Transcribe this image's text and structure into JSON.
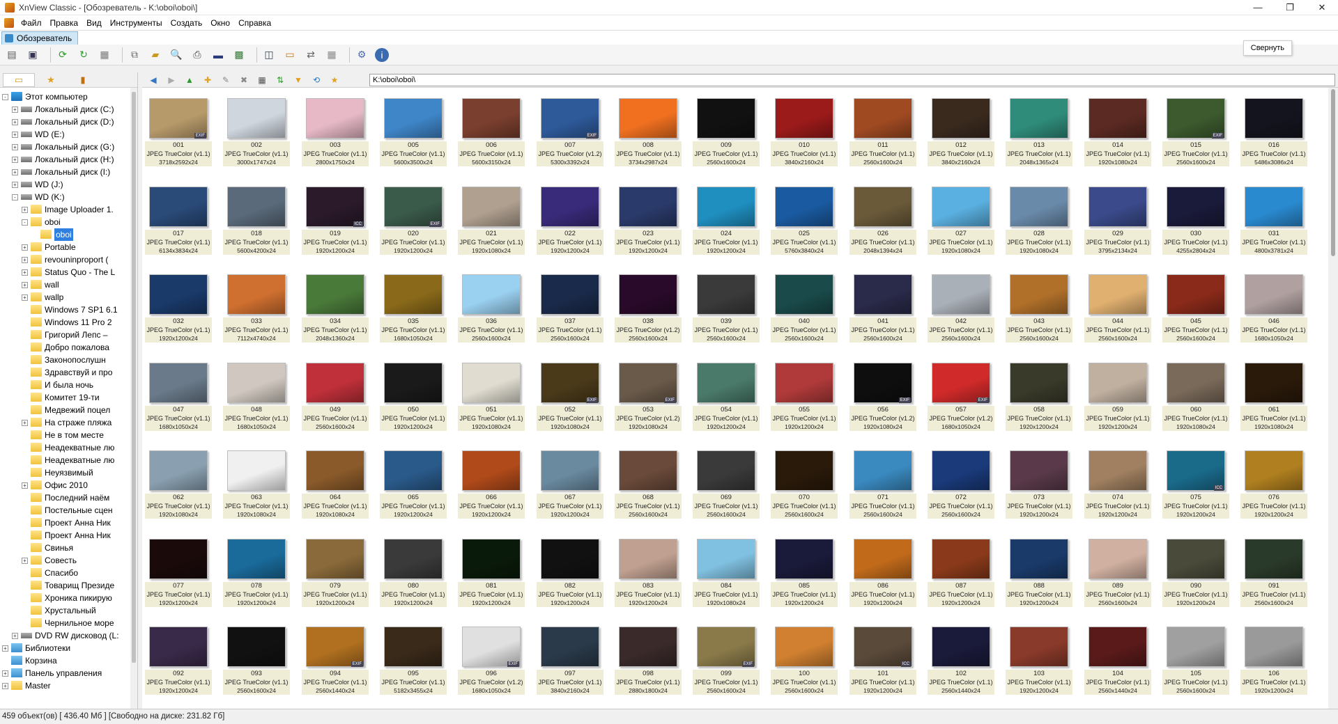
{
  "window": {
    "title": "XnView Classic - [Обозреватель - K:\\oboi\\oboi\\]",
    "tooltip": "Свернуть"
  },
  "menu": [
    "Файл",
    "Правка",
    "Вид",
    "Инструменты",
    "Создать",
    "Окно",
    "Справка"
  ],
  "tab": {
    "label": "Обозреватель"
  },
  "address": "K:\\oboi\\oboi\\",
  "tree": [
    {
      "label": "Этот компьютер",
      "level": 0,
      "icon": "pc",
      "exp": "-"
    },
    {
      "label": "Локальный диск (C:)",
      "level": 1,
      "icon": "disk",
      "exp": "+"
    },
    {
      "label": "Локальный диск (D:)",
      "level": 1,
      "icon": "disk",
      "exp": "+"
    },
    {
      "label": "WD (E:)",
      "level": 1,
      "icon": "disk",
      "exp": "+"
    },
    {
      "label": "Локальный диск (G:)",
      "level": 1,
      "icon": "disk",
      "exp": "+"
    },
    {
      "label": "Локальный диск (H:)",
      "level": 1,
      "icon": "disk",
      "exp": "+"
    },
    {
      "label": "Локальный диск (I:)",
      "level": 1,
      "icon": "disk",
      "exp": "+"
    },
    {
      "label": "WD (J:)",
      "level": 1,
      "icon": "disk",
      "exp": "+"
    },
    {
      "label": "WD (K:)",
      "level": 1,
      "icon": "disk",
      "exp": "-"
    },
    {
      "label": "Image Uploader 1.",
      "level": 2,
      "icon": "folder",
      "exp": "+"
    },
    {
      "label": "oboi",
      "level": 2,
      "icon": "folder",
      "exp": "-"
    },
    {
      "label": "oboi",
      "level": 3,
      "icon": "folder",
      "exp": "",
      "selected": true
    },
    {
      "label": "Portable",
      "level": 2,
      "icon": "folder",
      "exp": "+"
    },
    {
      "label": "revouninproport (",
      "level": 2,
      "icon": "folder",
      "exp": "+"
    },
    {
      "label": "Status Quo - The L",
      "level": 2,
      "icon": "folder",
      "exp": "+"
    },
    {
      "label": "wall",
      "level": 2,
      "icon": "folder",
      "exp": "+"
    },
    {
      "label": "wallp",
      "level": 2,
      "icon": "folder",
      "exp": "+"
    },
    {
      "label": "Windows 7 SP1 6.1",
      "level": 2,
      "icon": "folder",
      "exp": ""
    },
    {
      "label": "Windows 11 Pro 2",
      "level": 2,
      "icon": "folder",
      "exp": ""
    },
    {
      "label": "Григорий Лепс –",
      "level": 2,
      "icon": "folder",
      "exp": ""
    },
    {
      "label": "Добро пожалова",
      "level": 2,
      "icon": "folder",
      "exp": ""
    },
    {
      "label": "Законопослушн",
      "level": 2,
      "icon": "folder",
      "exp": ""
    },
    {
      "label": "Здравствуй и про",
      "level": 2,
      "icon": "folder",
      "exp": ""
    },
    {
      "label": "И была ночь",
      "level": 2,
      "icon": "folder",
      "exp": ""
    },
    {
      "label": "Комитет 19-ти",
      "level": 2,
      "icon": "folder",
      "exp": ""
    },
    {
      "label": "Медвежий поцел",
      "level": 2,
      "icon": "folder",
      "exp": ""
    },
    {
      "label": "На страже пляжа",
      "level": 2,
      "icon": "folder",
      "exp": "+"
    },
    {
      "label": "Не в том месте",
      "level": 2,
      "icon": "folder",
      "exp": ""
    },
    {
      "label": "Неадекватные лю",
      "level": 2,
      "icon": "folder",
      "exp": ""
    },
    {
      "label": "Неадекватные лю",
      "level": 2,
      "icon": "folder",
      "exp": ""
    },
    {
      "label": "Неуязвимый",
      "level": 2,
      "icon": "folder",
      "exp": ""
    },
    {
      "label": "Офис 2010",
      "level": 2,
      "icon": "folder",
      "exp": "+"
    },
    {
      "label": "Последний наём",
      "level": 2,
      "icon": "folder",
      "exp": ""
    },
    {
      "label": "Постельные сцен",
      "level": 2,
      "icon": "folder",
      "exp": ""
    },
    {
      "label": "Проект Анна Ник",
      "level": 2,
      "icon": "folder",
      "exp": ""
    },
    {
      "label": "Проект Анна Ник",
      "level": 2,
      "icon": "folder",
      "exp": ""
    },
    {
      "label": "Свинья",
      "level": 2,
      "icon": "folder",
      "exp": ""
    },
    {
      "label": "Совесть",
      "level": 2,
      "icon": "folder",
      "exp": "+"
    },
    {
      "label": "Спасибо",
      "level": 2,
      "icon": "folder",
      "exp": ""
    },
    {
      "label": "Товарищ Президе",
      "level": 2,
      "icon": "folder",
      "exp": ""
    },
    {
      "label": "Хроника пикирую",
      "level": 2,
      "icon": "folder",
      "exp": ""
    },
    {
      "label": "Хрустальный",
      "level": 2,
      "icon": "folder",
      "exp": ""
    },
    {
      "label": "Чернильное море",
      "level": 2,
      "icon": "folder",
      "exp": ""
    },
    {
      "label": "DVD RW дисковод (L:",
      "level": 1,
      "icon": "disk",
      "exp": "+"
    },
    {
      "label": "Библиотеки",
      "level": 0,
      "icon": "lib",
      "exp": "+"
    },
    {
      "label": "Корзина",
      "level": 0,
      "icon": "lib",
      "exp": ""
    },
    {
      "label": "Панель управления",
      "level": 0,
      "icon": "lib",
      "exp": "+"
    },
    {
      "label": "Master",
      "level": 0,
      "icon": "folder",
      "exp": "+"
    }
  ],
  "thumbs": [
    {
      "n": "001",
      "f": "JPEG TrueColor (v1.1)",
      "d": "3718x2592x24",
      "c": "#b79a6a",
      "b": "EXIF"
    },
    {
      "n": "002",
      "f": "JPEG TrueColor (v1.1)",
      "d": "3000x1747x24",
      "c": "#cfd6de"
    },
    {
      "n": "003",
      "f": "JPEG TrueColor (v1.1)",
      "d": "2800x1750x24",
      "c": "#e7b9c6"
    },
    {
      "n": "005",
      "f": "JPEG TrueColor (v1.1)",
      "d": "5600x3500x24",
      "c": "#3f86c9"
    },
    {
      "n": "006",
      "f": "JPEG TrueColor (v1.1)",
      "d": "5600x3150x24",
      "c": "#7a3f2e"
    },
    {
      "n": "007",
      "f": "JPEG TrueColor (v1.2)",
      "d": "5300x3392x24",
      "c": "#2e5a9a",
      "b": "EXIF"
    },
    {
      "n": "008",
      "f": "JPEG TrueColor (v1.1)",
      "d": "3734x2987x24",
      "c": "#f07020"
    },
    {
      "n": "009",
      "f": "JPEG TrueColor (v1.1)",
      "d": "2560x1600x24",
      "c": "#111111"
    },
    {
      "n": "010",
      "f": "JPEG TrueColor (v1.1)",
      "d": "3840x2160x24",
      "c": "#9b1a1a"
    },
    {
      "n": "011",
      "f": "JPEG TrueColor (v1.1)",
      "d": "2560x1600x24",
      "c": "#a04a22"
    },
    {
      "n": "012",
      "f": "JPEG TrueColor (v1.1)",
      "d": "3840x2160x24",
      "c": "#3a2a1e"
    },
    {
      "n": "013",
      "f": "JPEG TrueColor (v1.1)",
      "d": "2048x1365x24",
      "c": "#2f8c7a"
    },
    {
      "n": "014",
      "f": "JPEG TrueColor (v1.1)",
      "d": "1920x1080x24",
      "c": "#5b2a22"
    },
    {
      "n": "015",
      "f": "JPEG TrueColor (v1.1)",
      "d": "2560x1600x24",
      "c": "#3c5a2e",
      "b": "EXIF"
    },
    {
      "n": "016",
      "f": "JPEG TrueColor (v1.1)",
      "d": "5486x3086x24",
      "c": "#14141e"
    },
    {
      "n": "017",
      "f": "JPEG TrueColor (v1.1)",
      "d": "6134x3834x24",
      "c": "#2a4a78"
    },
    {
      "n": "018",
      "f": "JPEG TrueColor (v1.1)",
      "d": "5600x4200x24",
      "c": "#5a6a7a"
    },
    {
      "n": "019",
      "f": "JPEG TrueColor (v1.1)",
      "d": "1920x1200x24",
      "c": "#2a1a2a",
      "b": "ICC"
    },
    {
      "n": "020",
      "f": "JPEG TrueColor (v1.1)",
      "d": "1920x1200x24",
      "c": "#3a5a4a",
      "b": "EXIF"
    },
    {
      "n": "021",
      "f": "JPEG TrueColor (v1.1)",
      "d": "1920x1080x24",
      "c": "#b0a090"
    },
    {
      "n": "022",
      "f": "JPEG TrueColor (v1.1)",
      "d": "1920x1200x24",
      "c": "#3a2a7a"
    },
    {
      "n": "023",
      "f": "JPEG TrueColor (v1.1)",
      "d": "1920x1200x24",
      "c": "#2a3a6a"
    },
    {
      "n": "024",
      "f": "JPEG TrueColor (v1.1)",
      "d": "1920x1200x24",
      "c": "#1f8fc0"
    },
    {
      "n": "025",
      "f": "JPEG TrueColor (v1.1)",
      "d": "5760x3840x24",
      "c": "#1a5aa0"
    },
    {
      "n": "026",
      "f": "JPEG TrueColor (v1.1)",
      "d": "2048x1394x24",
      "c": "#6a5a3a"
    },
    {
      "n": "027",
      "f": "JPEG TrueColor (v1.1)",
      "d": "1920x1080x24",
      "c": "#5ab0e0"
    },
    {
      "n": "028",
      "f": "JPEG TrueColor (v1.1)",
      "d": "1920x1080x24",
      "c": "#6a8aaa"
    },
    {
      "n": "029",
      "f": "JPEG TrueColor (v1.1)",
      "d": "3795x2134x24",
      "c": "#3a4a8a"
    },
    {
      "n": "030",
      "f": "JPEG TrueColor (v1.1)",
      "d": "4255x2804x24",
      "c": "#1a1a3a"
    },
    {
      "n": "031",
      "f": "JPEG TrueColor (v1.1)",
      "d": "4800x3781x24",
      "c": "#2a8ad0"
    },
    {
      "n": "032",
      "f": "JPEG TrueColor (v1.1)",
      "d": "1920x1200x24",
      "c": "#1a3a6a"
    },
    {
      "n": "033",
      "f": "JPEG TrueColor (v1.1)",
      "d": "7112x4740x24",
      "c": "#d07030"
    },
    {
      "n": "034",
      "f": "JPEG TrueColor (v1.1)",
      "d": "2048x1360x24",
      "c": "#4a7a3a"
    },
    {
      "n": "035",
      "f": "JPEG TrueColor (v1.1)",
      "d": "1680x1050x24",
      "c": "#8a6a1a"
    },
    {
      "n": "036",
      "f": "JPEG TrueColor (v1.1)",
      "d": "2560x1600x24",
      "c": "#9ad0f0"
    },
    {
      "n": "037",
      "f": "JPEG TrueColor (v1.1)",
      "d": "2560x1600x24",
      "c": "#1a2a4a"
    },
    {
      "n": "038",
      "f": "JPEG TrueColor (v1.2)",
      "d": "2560x1600x24",
      "c": "#2a0a2a"
    },
    {
      "n": "039",
      "f": "JPEG TrueColor (v1.1)",
      "d": "2560x1600x24",
      "c": "#3a3a3a"
    },
    {
      "n": "040",
      "f": "JPEG TrueColor (v1.1)",
      "d": "2560x1600x24",
      "c": "#1a4a4a"
    },
    {
      "n": "041",
      "f": "JPEG TrueColor (v1.1)",
      "d": "2560x1600x24",
      "c": "#2a2a4a"
    },
    {
      "n": "042",
      "f": "JPEG TrueColor (v1.1)",
      "d": "2560x1600x24",
      "c": "#aab0b8"
    },
    {
      "n": "043",
      "f": "JPEG TrueColor (v1.1)",
      "d": "2560x1600x24",
      "c": "#b0702a"
    },
    {
      "n": "044",
      "f": "JPEG TrueColor (v1.1)",
      "d": "2560x1600x24",
      "c": "#e0b070"
    },
    {
      "n": "045",
      "f": "JPEG TrueColor (v1.1)",
      "d": "2560x1600x24",
      "c": "#8a2a1a"
    },
    {
      "n": "046",
      "f": "JPEG TrueColor (v1.1)",
      "d": "1680x1050x24",
      "c": "#b0a0a0"
    },
    {
      "n": "047",
      "f": "JPEG TrueColor (v1.1)",
      "d": "1680x1050x24",
      "c": "#6a7a8a"
    },
    {
      "n": "048",
      "f": "JPEG TrueColor (v1.1)",
      "d": "1680x1050x24",
      "c": "#d0c8c0"
    },
    {
      "n": "049",
      "f": "JPEG TrueColor (v1.1)",
      "d": "2560x1600x24",
      "c": "#c0303a"
    },
    {
      "n": "050",
      "f": "JPEG TrueColor (v1.1)",
      "d": "1920x1200x24",
      "c": "#1a1a1a"
    },
    {
      "n": "051",
      "f": "JPEG TrueColor (v1.1)",
      "d": "1920x1080x24",
      "c": "#e0dcd0"
    },
    {
      "n": "052",
      "f": "JPEG TrueColor (v1.1)",
      "d": "1920x1080x24",
      "c": "#4a3a1a",
      "b": "EXIF"
    },
    {
      "n": "053",
      "f": "JPEG TrueColor (v1.2)",
      "d": "1920x1080x24",
      "c": "#6a5a4a",
      "b": "EXIF"
    },
    {
      "n": "054",
      "f": "JPEG TrueColor (v1.1)",
      "d": "1920x1200x24",
      "c": "#4a7a6a"
    },
    {
      "n": "055",
      "f": "JPEG TrueColor (v1.1)",
      "d": "1920x1200x24",
      "c": "#b03a3a"
    },
    {
      "n": "056",
      "f": "JPEG TrueColor (v1.2)",
      "d": "1920x1080x24",
      "c": "#0e0e0e",
      "b": "EXIF"
    },
    {
      "n": "057",
      "f": "JPEG TrueColor (v1.2)",
      "d": "1680x1050x24",
      "c": "#d02a2a",
      "b": "EXIF"
    },
    {
      "n": "058",
      "f": "JPEG TrueColor (v1.1)",
      "d": "1920x1200x24",
      "c": "#3a3a2a"
    },
    {
      "n": "059",
      "f": "JPEG TrueColor (v1.1)",
      "d": "1920x1200x24",
      "c": "#c0b0a0"
    },
    {
      "n": "060",
      "f": "JPEG TrueColor (v1.1)",
      "d": "1920x1080x24",
      "c": "#7a6a5a"
    },
    {
      "n": "061",
      "f": "JPEG TrueColor (v1.1)",
      "d": "1920x1080x24",
      "c": "#2a1a0a"
    },
    {
      "n": "062",
      "f": "JPEG TrueColor (v1.1)",
      "d": "1920x1080x24",
      "c": "#8aa0b0"
    },
    {
      "n": "063",
      "f": "JPEG TrueColor (v1.1)",
      "d": "1920x1080x24",
      "c": "#f0f0f0"
    },
    {
      "n": "064",
      "f": "JPEG TrueColor (v1.1)",
      "d": "1920x1080x24",
      "c": "#8a5a2a"
    },
    {
      "n": "065",
      "f": "JPEG TrueColor (v1.1)",
      "d": "1920x1200x24",
      "c": "#2a5a8a"
    },
    {
      "n": "066",
      "f": "JPEG TrueColor (v1.1)",
      "d": "1920x1200x24",
      "c": "#b04a1a"
    },
    {
      "n": "067",
      "f": "JPEG TrueColor (v1.1)",
      "d": "1920x1200x24",
      "c": "#6a8aa0"
    },
    {
      "n": "068",
      "f": "JPEG TrueColor (v1.1)",
      "d": "2560x1600x24",
      "c": "#6a4a3a"
    },
    {
      "n": "069",
      "f": "JPEG TrueColor (v1.1)",
      "d": "2560x1600x24",
      "c": "#3a3a3a"
    },
    {
      "n": "070",
      "f": "JPEG TrueColor (v1.1)",
      "d": "2560x1600x24",
      "c": "#2a1a0a"
    },
    {
      "n": "071",
      "f": "JPEG TrueColor (v1.1)",
      "d": "2560x1600x24",
      "c": "#3a8ac0"
    },
    {
      "n": "072",
      "f": "JPEG TrueColor (v1.1)",
      "d": "2560x1600x24",
      "c": "#1a3a7a"
    },
    {
      "n": "073",
      "f": "JPEG TrueColor (v1.1)",
      "d": "1920x1200x24",
      "c": "#5a3a4a"
    },
    {
      "n": "074",
      "f": "JPEG TrueColor (v1.1)",
      "d": "1920x1200x24",
      "c": "#a08060"
    },
    {
      "n": "075",
      "f": "JPEG TrueColor (v1.1)",
      "d": "1920x1200x24",
      "c": "#1a6a8a",
      "b": "ICC"
    },
    {
      "n": "076",
      "f": "JPEG TrueColor (v1.1)",
      "d": "1920x1200x24",
      "c": "#b08020"
    },
    {
      "n": "077",
      "f": "JPEG TrueColor (v1.1)",
      "d": "1920x1200x24",
      "c": "#1a0a0a"
    },
    {
      "n": "078",
      "f": "JPEG TrueColor (v1.1)",
      "d": "1920x1200x24",
      "c": "#1a6a9a"
    },
    {
      "n": "079",
      "f": "JPEG TrueColor (v1.1)",
      "d": "1920x1200x24",
      "c": "#8a6a3a"
    },
    {
      "n": "080",
      "f": "JPEG TrueColor (v1.1)",
      "d": "1920x1200x24",
      "c": "#3a3a3a"
    },
    {
      "n": "081",
      "f": "JPEG TrueColor (v1.1)",
      "d": "1920x1200x24",
      "c": "#0a1a0a"
    },
    {
      "n": "082",
      "f": "JPEG TrueColor (v1.1)",
      "d": "1920x1200x24",
      "c": "#111111"
    },
    {
      "n": "083",
      "f": "JPEG TrueColor (v1.1)",
      "d": "1920x1200x24",
      "c": "#c0a090"
    },
    {
      "n": "084",
      "f": "JPEG TrueColor (v1.1)",
      "d": "1920x1080x24",
      "c": "#80c0e0"
    },
    {
      "n": "085",
      "f": "JPEG TrueColor (v1.1)",
      "d": "1920x1200x24",
      "c": "#1a1a3a"
    },
    {
      "n": "086",
      "f": "JPEG TrueColor (v1.1)",
      "d": "1920x1200x24",
      "c": "#c06a1a"
    },
    {
      "n": "087",
      "f": "JPEG TrueColor (v1.1)",
      "d": "1920x1200x24",
      "c": "#8a3a1a"
    },
    {
      "n": "088",
      "f": "JPEG TrueColor (v1.1)",
      "d": "1920x1200x24",
      "c": "#1a3a6a"
    },
    {
      "n": "089",
      "f": "JPEG TrueColor (v1.1)",
      "d": "2560x1600x24",
      "c": "#d0b0a0"
    },
    {
      "n": "090",
      "f": "JPEG TrueColor (v1.1)",
      "d": "1920x1200x24",
      "c": "#4a4a3a"
    },
    {
      "n": "091",
      "f": "JPEG TrueColor (v1.1)",
      "d": "2560x1600x24",
      "c": "#2a3a2a"
    },
    {
      "n": "092",
      "f": "JPEG TrueColor (v1.1)",
      "d": "1920x1200x24",
      "c": "#3a2a4a"
    },
    {
      "n": "093",
      "f": "JPEG TrueColor (v1.1)",
      "d": "2560x1600x24",
      "c": "#111111"
    },
    {
      "n": "094",
      "f": "JPEG TrueColor (v1.1)",
      "d": "2560x1440x24",
      "c": "#b07020",
      "b": "EXIF"
    },
    {
      "n": "095",
      "f": "JPEG TrueColor (v1.1)",
      "d": "5182x3455x24",
      "c": "#3a2a1a"
    },
    {
      "n": "096",
      "f": "JPEG TrueColor (v1.2)",
      "d": "1680x1050x24",
      "c": "#e0e0e0",
      "b": "EXIF"
    },
    {
      "n": "097",
      "f": "JPEG TrueColor (v1.1)",
      "d": "3840x2160x24",
      "c": "#2a3a4a"
    },
    {
      "n": "098",
      "f": "JPEG TrueColor (v1.1)",
      "d": "2880x1800x24",
      "c": "#3a2a2a"
    },
    {
      "n": "099",
      "f": "JPEG TrueColor (v1.1)",
      "d": "2560x1600x24",
      "c": "#8a7a4a",
      "b": "EXIF"
    },
    {
      "n": "100",
      "f": "JPEG TrueColor (v1.1)",
      "d": "2560x1600x24",
      "c": "#d08030"
    },
    {
      "n": "101",
      "f": "JPEG TrueColor (v1.1)",
      "d": "1920x1200x24",
      "c": "#5a4a3a",
      "b": "ICC"
    },
    {
      "n": "102",
      "f": "JPEG TrueColor (v1.1)",
      "d": "2560x1440x24",
      "c": "#1a1a3a"
    },
    {
      "n": "103",
      "f": "JPEG TrueColor (v1.1)",
      "d": "1920x1200x24",
      "c": "#8a3a2a"
    },
    {
      "n": "104",
      "f": "JPEG TrueColor (v1.1)",
      "d": "2560x1440x24",
      "c": "#5a1a1a"
    },
    {
      "n": "105",
      "f": "JPEG TrueColor (v1.1)",
      "d": "2560x1600x24",
      "c": "#a0a0a0"
    },
    {
      "n": "106",
      "f": "JPEG TrueColor (v1.1)",
      "d": "1920x1200x24",
      "c": "#9a9a9a"
    }
  ],
  "status": "459 объект(ов) [ 436.40 Мб ] [Свободно на диске: 231.82 Гб]"
}
